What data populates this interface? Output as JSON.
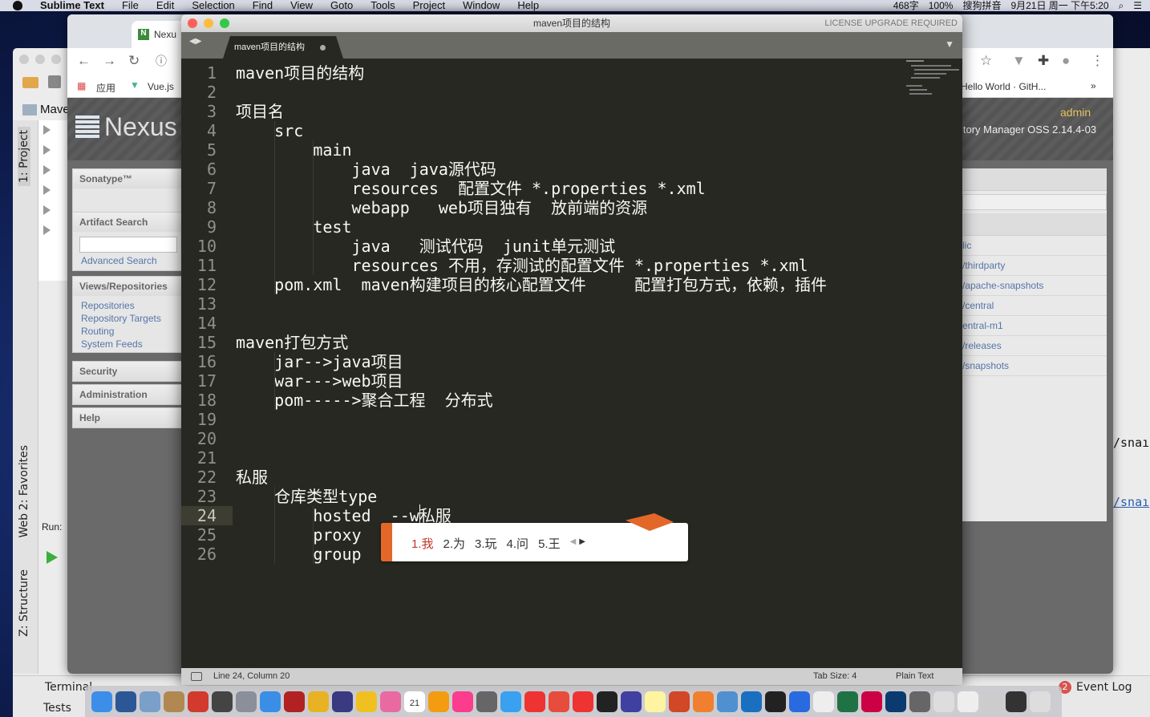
{
  "menubar": {
    "apple": "",
    "app": "Sublime Text",
    "items": [
      "File",
      "Edit",
      "Selection",
      "Find",
      "View",
      "Goto",
      "Tools",
      "Project",
      "Window",
      "Help"
    ],
    "status": [
      "468字",
      "100%",
      "搜狗拼音",
      "9月21日 周一 下午5:20"
    ]
  },
  "ide": {
    "project_title": "Mave",
    "tool_windows": {
      "project": "1: Project",
      "favorites": "2: Favorites",
      "web": "Web",
      "structure": "Z: Structure",
      "run": "Run:"
    },
    "bottom": {
      "terminal": "Terminal",
      "tests": "Tests",
      "event_log": "Event Log",
      "event_count": "2"
    },
    "right_text": [
      "/snaı",
      "/snaı"
    ]
  },
  "browser": {
    "tab_title": "Nexu",
    "bookmarks": [
      {
        "label": "应用"
      },
      {
        "label": "Vue.js"
      },
      {
        "label": "Hello World · GitH..."
      }
    ],
    "more": "»"
  },
  "nexus": {
    "logo": "Nexus",
    "user": "admin",
    "version": "itory Manager OSS 2.14.4-03",
    "sonatype": "Sonatype™",
    "panels": [
      {
        "title": "Artifact Search",
        "links": [
          "Advanced Search"
        ]
      },
      {
        "title": "Views/Repositories",
        "links": [
          "Repositories",
          "Repository Targets",
          "Routing",
          "System Feeds"
        ]
      },
      {
        "title": "Security",
        "links": []
      },
      {
        "title": "Administration",
        "links": []
      },
      {
        "title": "Help",
        "links": []
      }
    ],
    "repos": [
      "lic",
      "/thirdparty",
      "/apache-snapshots",
      "/central",
      "entral-m1",
      "/releases",
      "/snapshots"
    ]
  },
  "sublime": {
    "title": "maven项目的结构",
    "license": "LICENSE UPGRADE REQUIRED",
    "tab": "maven项目的结构",
    "current_line": 24,
    "lines": [
      "maven项目的结构",
      "",
      "项目名",
      "    src",
      "        main",
      "            java  java源代码",
      "            resources  配置文件 *.properties *.xml",
      "            webapp   web项目独有  放前端的资源",
      "        test",
      "            java   测试代码  junit单元测试",
      "            resources 不用，存测试的配置文件 *.properties *.xml",
      "    pom.xml  maven构建项目的核心配置文件     配置打包方式，依赖，插件",
      "",
      "",
      "maven打包方式",
      "    jar-->java项目",
      "    war--->web项目",
      "    pom----->聚合工程  分布式",
      "",
      "",
      "",
      "私服",
      "    仓库类型type",
      "        hosted  --w私服",
      "        proxy",
      "        group"
    ],
    "status": {
      "position": "Line 24, Column 20",
      "tab_size": "Tab Size: 4",
      "syntax": "Plain Text"
    }
  },
  "ime": {
    "candidates": [
      "1.我",
      "2.为",
      "3.玩",
      "4.问",
      "5.王"
    ],
    "highlight": "#c0392b",
    "accent": "#e4672a"
  },
  "dock": {
    "icons": [
      "finder",
      "word",
      "preview",
      "notes-brown",
      "redis",
      "sublime",
      "launchpad",
      "safari",
      "filezilla",
      "chrome",
      "eclipse",
      "star",
      "photos",
      "calendar",
      "books",
      "music",
      "system-prefs",
      "messages",
      "parallels",
      "hbuilder",
      "xmind",
      "intellij",
      "siri",
      "notes",
      "powerpoint",
      "colors",
      "pen",
      "display",
      "terminal",
      "wps",
      "typora",
      "excel",
      "monitor",
      "windows",
      "printer",
      "app1",
      "doc",
      "app2",
      "app3",
      "trash"
    ],
    "calendar_day": "21"
  }
}
